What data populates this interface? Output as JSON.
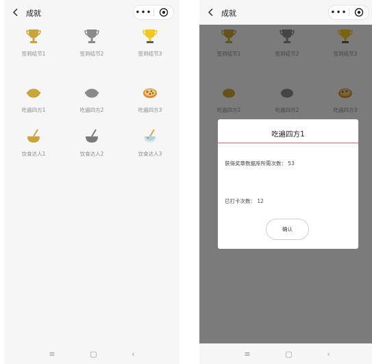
{
  "colors": {
    "gold": "#c9a53a",
    "gray": "#8a8a8a",
    "bright_gold": "#f3c81b",
    "mask": "rgba(0,0,0,0.5)",
    "accent_line": "#e2636c"
  },
  "screens": {
    "left": {
      "nav": {
        "title": "成就",
        "back_icon": "chevron-left-icon",
        "menu_icon": "•••",
        "target_icon": "target-icon"
      },
      "badges": [
        {
          "label": "签到结节1",
          "icon": "trophy-icon",
          "color": "gold"
        },
        {
          "label": "签到结节2",
          "icon": "trophy-icon",
          "color": "gray"
        },
        {
          "label": "签到结节3",
          "icon": "trophy-icon",
          "color": "bright_gold"
        },
        {
          "label": "吃遍四方1",
          "icon": "bowl-icon",
          "color": "gold"
        },
        {
          "label": "吃遍四方2",
          "icon": "bowl-icon",
          "color": "gray"
        },
        {
          "label": "吃遍四方3",
          "icon": "pizza-icon",
          "color": "multicolor"
        },
        {
          "label": "饮食达人1",
          "icon": "pan-icon",
          "color": "gold"
        },
        {
          "label": "饮食达人2",
          "icon": "pan-icon",
          "color": "gray"
        },
        {
          "label": "饮食达人3",
          "icon": "pan-icon",
          "color": "multicolor"
        }
      ],
      "bottom_bar": {
        "home": "≡",
        "square": "▢",
        "back": "‹"
      }
    },
    "right": {
      "nav": {
        "title": "成就"
      },
      "modal": {
        "title": "吃遍四方1",
        "description": "获得奖章数据库所需次数：",
        "description_value": "53",
        "count_label": "已打卡次数：",
        "count_value": "12",
        "confirm_label": "确认"
      },
      "bottom_bar": {
        "home": "≡",
        "square": "▢",
        "back": "‹"
      }
    }
  }
}
